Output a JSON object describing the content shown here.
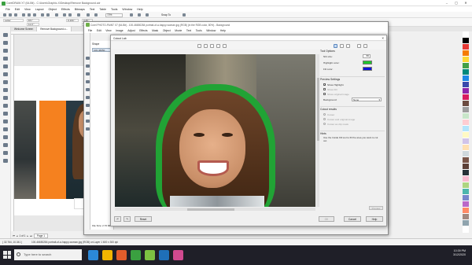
{
  "main_app": {
    "title": "CorelDRAW X7 (64-Bit) - C:\\Users\\Graphic-X\\Desktop\\Remove Background.cdr",
    "menu": [
      "File",
      "Edit",
      "View",
      "Layout",
      "Object",
      "Effects",
      "Bitmaps",
      "Text",
      "Table",
      "Tools",
      "Window",
      "Help"
    ],
    "zoom": "72%",
    "snap_to": "Snap To",
    "prop_fields": [
      "Letter",
      "8.5 \"",
      "11.0 \"",
      "0.100 \"",
      "0.25 \"",
      "0.25 \""
    ],
    "doc_tabs": [
      "Welcome Screen",
      "Remove Background.c..."
    ],
    "page_nav": {
      "count": "1 of 1",
      "page_tab": "Page 1"
    },
    "status_left": "( 32.764, 10.341 )",
    "status_mid": "100-46650284 portrait-of-a-happy-woman.jpg (RGB) on Layer 1 600 x 300 dpi"
  },
  "photopaint": {
    "title": "Corel PHOTO-PAINT X7 (64-Bit) - 100-46650284 portrait-of-a-happy-woman.jpg (RGB) (in the RGB color, 80%) - Background",
    "menu": [
      "File",
      "Edit",
      "View",
      "Image",
      "Adjust",
      "Effects",
      "Mask",
      "Object",
      "Movie",
      "Text",
      "Tools",
      "Window",
      "Help"
    ],
    "objects_label": "Shape",
    "objects_row": "100-46650...",
    "file_size": "File Size: 2.76 MB"
  },
  "cutout_lab": {
    "title": "Cutout Lab",
    "close": "×",
    "tool_options": {
      "heading": "Tool Options",
      "nib_size_label": "Nib size:",
      "nib_size_value": "80",
      "highlight_color_label": "Highlight color:",
      "fill_color_label": "Fill color:",
      "highlight_color": "#1fc42c",
      "fill_color": "#0f12d8"
    },
    "preview_settings": {
      "heading": "Preview Settings",
      "show_highlight": "Show Highlight",
      "show_fill": "Show Fill",
      "show_original": "Show original image",
      "background_label": "Background:",
      "background_value": "None"
    },
    "cutout_results": {
      "heading": "Cutout results",
      "options": [
        "Cutout",
        "Cutout and original image",
        "Cutout as clip mask"
      ]
    },
    "hints": {
      "heading": "Hints",
      "text": "Use the Inside Fill tool to fill the area you want to cut out."
    },
    "preview_button": "Preview",
    "buttons": {
      "reset": "Reset",
      "ok": "OK",
      "cancel": "Cancel",
      "help": "Help"
    }
  },
  "taskbar": {
    "search_placeholder": "Type here to search",
    "time": "10:39 PM",
    "date": "3/12/2020"
  },
  "palette_colors": [
    "#ffffff",
    "#000000",
    "#e53935",
    "#f57c00",
    "#fdd835",
    "#43a047",
    "#00897b",
    "#1e88e5",
    "#3949ab",
    "#8e24aa",
    "#d81b60",
    "#6d4c41",
    "#9e9e9e",
    "#c8e6c9",
    "#ffcdd2",
    "#b3e5fc",
    "#fff9c4",
    "#d1c4e9",
    "#ffe0b2",
    "#cfd8dc",
    "#795548",
    "#5d4037",
    "#263238",
    "#f8bbd0",
    "#aed581",
    "#4db6ac",
    "#7986cb",
    "#ba68c8",
    "#ff8a65",
    "#a1887f",
    "#90a4ae",
    "#ffffff"
  ],
  "taskbar_app_colors": [
    "#2b88d8",
    "#f2b400",
    "#e25c2b",
    "#3aa040",
    "#7cc142",
    "#1f6fb8",
    "#d04a8f"
  ]
}
